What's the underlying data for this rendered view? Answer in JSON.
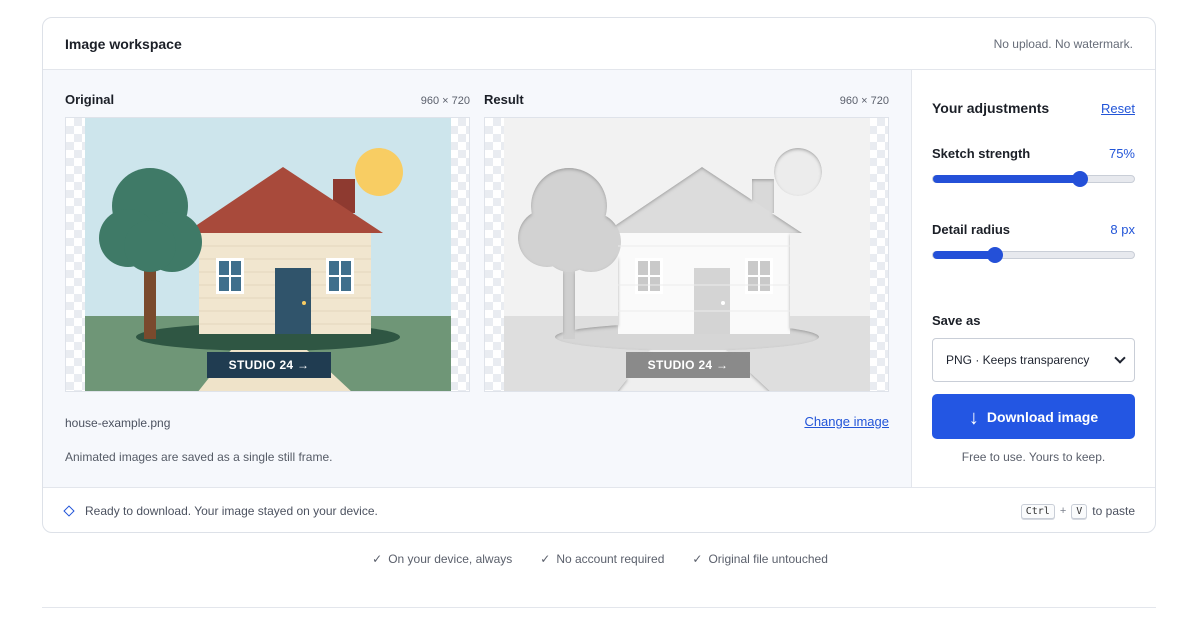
{
  "header": {
    "title": "Image workspace",
    "note": "No upload. No watermark."
  },
  "original": {
    "label": "Original",
    "dimensions": "960 × 720",
    "banner_text": "STUDIO 24 →"
  },
  "result": {
    "label": "Result",
    "dimensions": "960 × 720",
    "banner_text": "STUDIO 24 →"
  },
  "file": {
    "name": "house-example.png",
    "change_label": "Change image",
    "animated_note": "Animated images are saved as a single still frame."
  },
  "adjustments": {
    "title": "Your adjustments",
    "reset_label": "Reset",
    "sketch_strength": {
      "label": "Sketch strength",
      "value_text": "75%",
      "fraction": 0.73
    },
    "detail_radius": {
      "label": "Detail radius",
      "value_text": "8 px",
      "fraction": 0.31
    }
  },
  "save": {
    "label": "Save as",
    "selected_option": "PNG · Keeps transparency",
    "download_label": "Download image",
    "download_icon": "arrow-down-icon",
    "free_note": "Free to use. Yours to keep."
  },
  "status": {
    "text": "Ready to download. Your image stayed on your device.",
    "key1": "Ctrl",
    "plus": "+",
    "key2": "V",
    "paste_suffix": "to paste"
  },
  "features": [
    {
      "check": "✓",
      "text": "On your device, always"
    },
    {
      "check": "✓",
      "text": "No account required"
    },
    {
      "check": "✓",
      "text": "Original file untouched"
    }
  ],
  "colors": {
    "accent": "#2356e3",
    "link": "#2255d8",
    "sky": "#cde5ec",
    "ground": "#6f9677",
    "roof": "#a84a3b",
    "wall": "#f1e6cf",
    "door": "#30546b",
    "sun": "#f8cd63",
    "tree": "#3f7a67",
    "banner": "#203c51"
  }
}
